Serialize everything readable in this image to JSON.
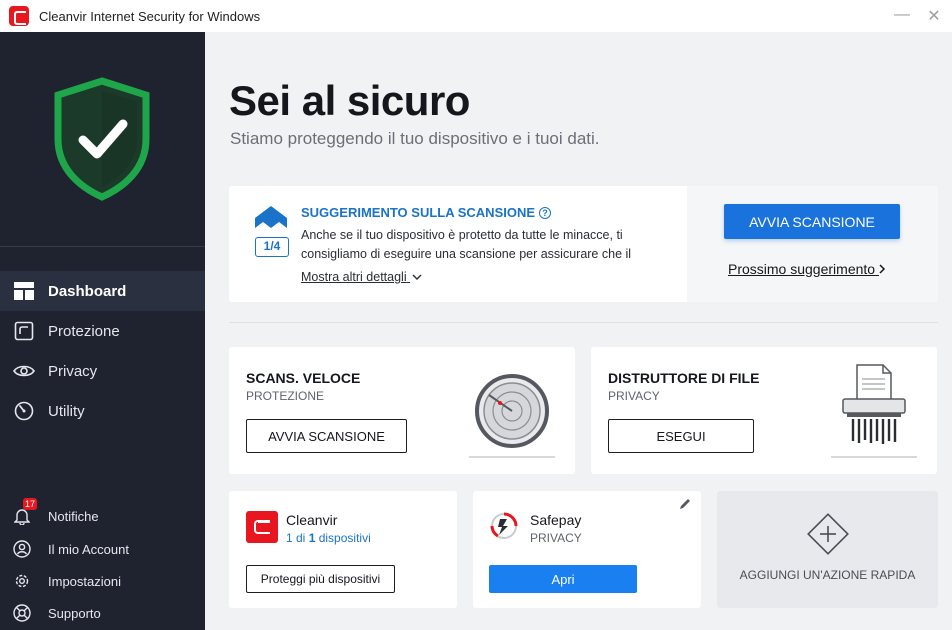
{
  "window": {
    "title": "Cleanvir Internet Security for Windows",
    "controls": {
      "minimize": "—",
      "close": "✕"
    }
  },
  "sidebar": {
    "nav": [
      {
        "label": "Dashboard",
        "icon": "dashboard-icon",
        "active": true
      },
      {
        "label": "Protezione",
        "icon": "protection-icon",
        "active": false
      },
      {
        "label": "Privacy",
        "icon": "eye-icon",
        "active": false
      },
      {
        "label": "Utility",
        "icon": "gauge-icon",
        "active": false
      }
    ],
    "bottom": [
      {
        "label": "Notifiche",
        "icon": "bell-icon",
        "badge": "17"
      },
      {
        "label": "Il mio Account",
        "icon": "user-icon"
      },
      {
        "label": "Impostazioni",
        "icon": "gear-icon"
      },
      {
        "label": "Supporto",
        "icon": "help-icon"
      }
    ]
  },
  "hero": {
    "title": "Sei al sicuro",
    "subtitle": "Stiamo proteggendo il tuo dispositivo e i tuoi dati."
  },
  "tip": {
    "counter": "1/4",
    "title": "SUGGERIMENTO SULLA SCANSIONE",
    "body": "Anche se il tuo dispositivo è protetto da tutte le minacce, ti consigliamo di eseguire una scansione per assicurare che il",
    "more_link": "Mostra altri dettagli",
    "primary_button": "AVVIA SCANSIONE",
    "next_link": "Prossimo suggerimento"
  },
  "cards": {
    "quick_scan": {
      "title": "SCANS. VELOCE",
      "subtitle": "PROTEZIONE",
      "button": "AVVIA SCANSIONE"
    },
    "shredder": {
      "title": "DISTRUTTORE DI FILE",
      "subtitle": "PRIVACY",
      "button": "ESEGUI"
    },
    "cleanvir": {
      "title": "Cleanvir",
      "devices_prefix": "1 di ",
      "devices_count": "1",
      "devices_suffix": " dispositivi",
      "button": "Proteggi più dispositivi"
    },
    "safepay": {
      "title": "Safepay",
      "subtitle": "PRIVACY",
      "button": "Apri"
    },
    "add_action": {
      "label": "AGGIUNGI UN'AZIONE RAPIDA"
    }
  },
  "colors": {
    "accent": "#1a73dc",
    "brand_red": "#e8171f",
    "sidebar_bg": "#1f2330",
    "shield_green": "#1fa64a"
  }
}
